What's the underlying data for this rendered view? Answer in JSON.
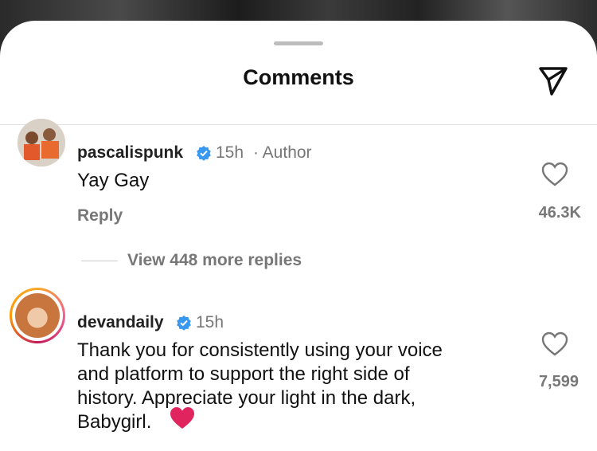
{
  "header": {
    "title": "Comments"
  },
  "comments": [
    {
      "username": "pascalispunk",
      "time": "15h",
      "role": "· Author",
      "text": "Yay Gay",
      "reply_label": "Reply",
      "likes": "46.3K",
      "view_more": "View 448 more replies"
    },
    {
      "username": "devandaily",
      "time": "15h",
      "text_lines": [
        "Thank you for consistently using your voice",
        "and platform to support the right side of",
        "history. Appreciate your light in the dark,",
        "Babygirl."
      ],
      "likes": "7,599"
    }
  ],
  "icons": [
    "send-icon",
    "verified-badge-icon",
    "heart-icon",
    "red-heart-emoji"
  ],
  "colors": {
    "verified": "#3897f0",
    "secondary_text": "#777777",
    "emoji_heart": "#e0245e"
  }
}
